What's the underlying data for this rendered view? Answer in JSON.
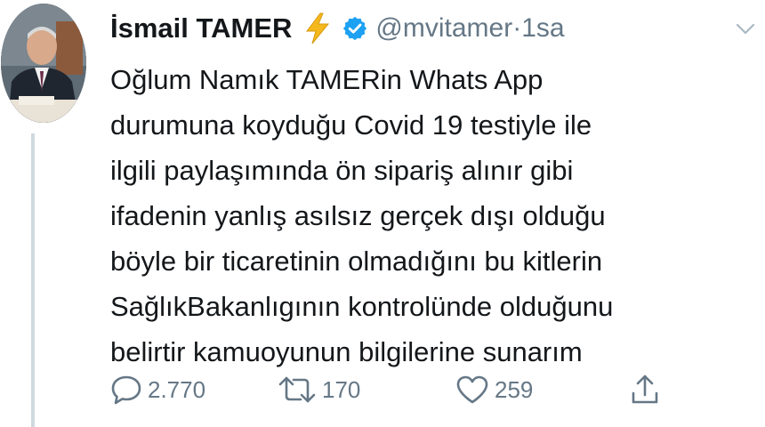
{
  "tweet": {
    "author_name": "İsmail TAMER",
    "handle": "@mvitamer",
    "separator": "·",
    "time": "1sa",
    "text_lines": [
      "Oğlum Namık TAMERin Whats App",
      "durumuna koyduğu Covid 19 testiyle ile",
      "ilgili paylaşımında ön sipariş alınır gibi",
      "ifadenin yanlış asılsız gerçek dışı olduğu",
      "böyle bir ticaretinin olmadığını bu kitlerin",
      "SağlıkBakanlıgının  kontrolünde olduğunu",
      "belirtir kamuoyunun bilgilerine sunarım"
    ]
  },
  "actions": {
    "replies": "2.770",
    "retweets": "170",
    "likes": "259"
  },
  "icons": {
    "badge_emoji": "lightning-bolt-icon",
    "verified": "verified-badge-icon",
    "menu": "chevron-down-icon",
    "reply": "reply-icon",
    "retweet": "retweet-icon",
    "like": "heart-icon",
    "share": "share-icon"
  },
  "colors": {
    "text": "#14171a",
    "secondary": "#657786",
    "verified_blue": "#1da1f2",
    "bolt_yellow": "#f5b81c",
    "thread_line": "#cfd9de"
  }
}
